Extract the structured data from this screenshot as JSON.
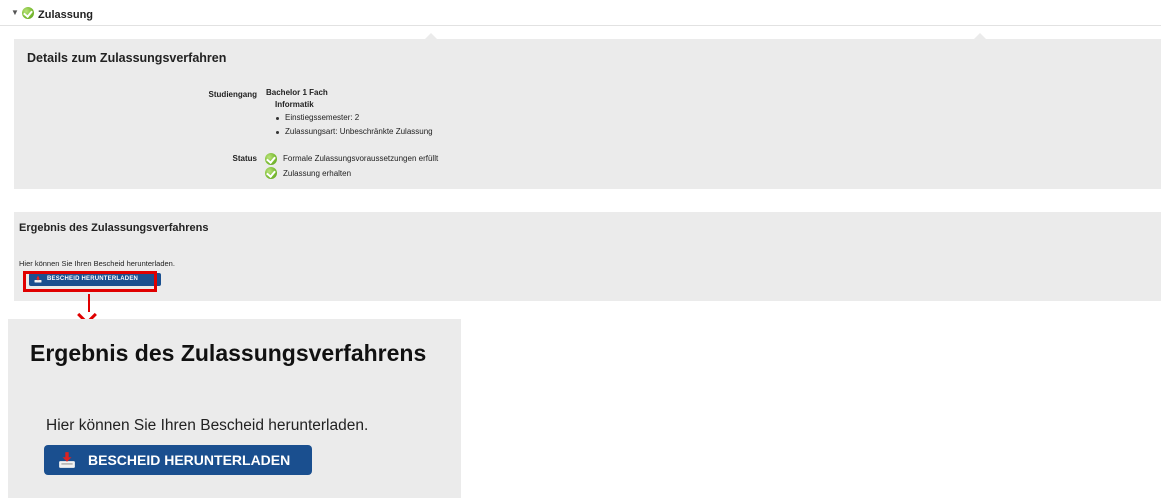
{
  "header": {
    "title": "Zulassung"
  },
  "details": {
    "heading": "Details zum Zulassungsverfahren",
    "studiengang_label": "Studiengang",
    "studiengang_value": "Bachelor 1 Fach",
    "fach": "Informatik",
    "bullets": [
      "Einstiegssemester: 2",
      "Zulassungsart: Unbeschränkte Zulassung"
    ],
    "status_label": "Status",
    "status_items": [
      "Formale Zulassungsvoraussetzungen erfüllt",
      "Zulassung erhalten"
    ]
  },
  "result": {
    "heading": "Ergebnis des Zulassungsverfahrens",
    "text": "Hier können Sie Ihren Bescheid herunterladen.",
    "button_label": "BESCHEID HERUNTERLADEN"
  },
  "zoom": {
    "heading": "Ergebnis des Zulassungsverfahrens",
    "text": "Hier können Sie Ihren Bescheid herunterladen.",
    "button_label": "BESCHEID HERUNTERLADEN"
  },
  "colors": {
    "accent_button": "#1a4f8f",
    "highlight": "#e00000",
    "panel": "#ebebeb",
    "check": "#7cbd34"
  }
}
